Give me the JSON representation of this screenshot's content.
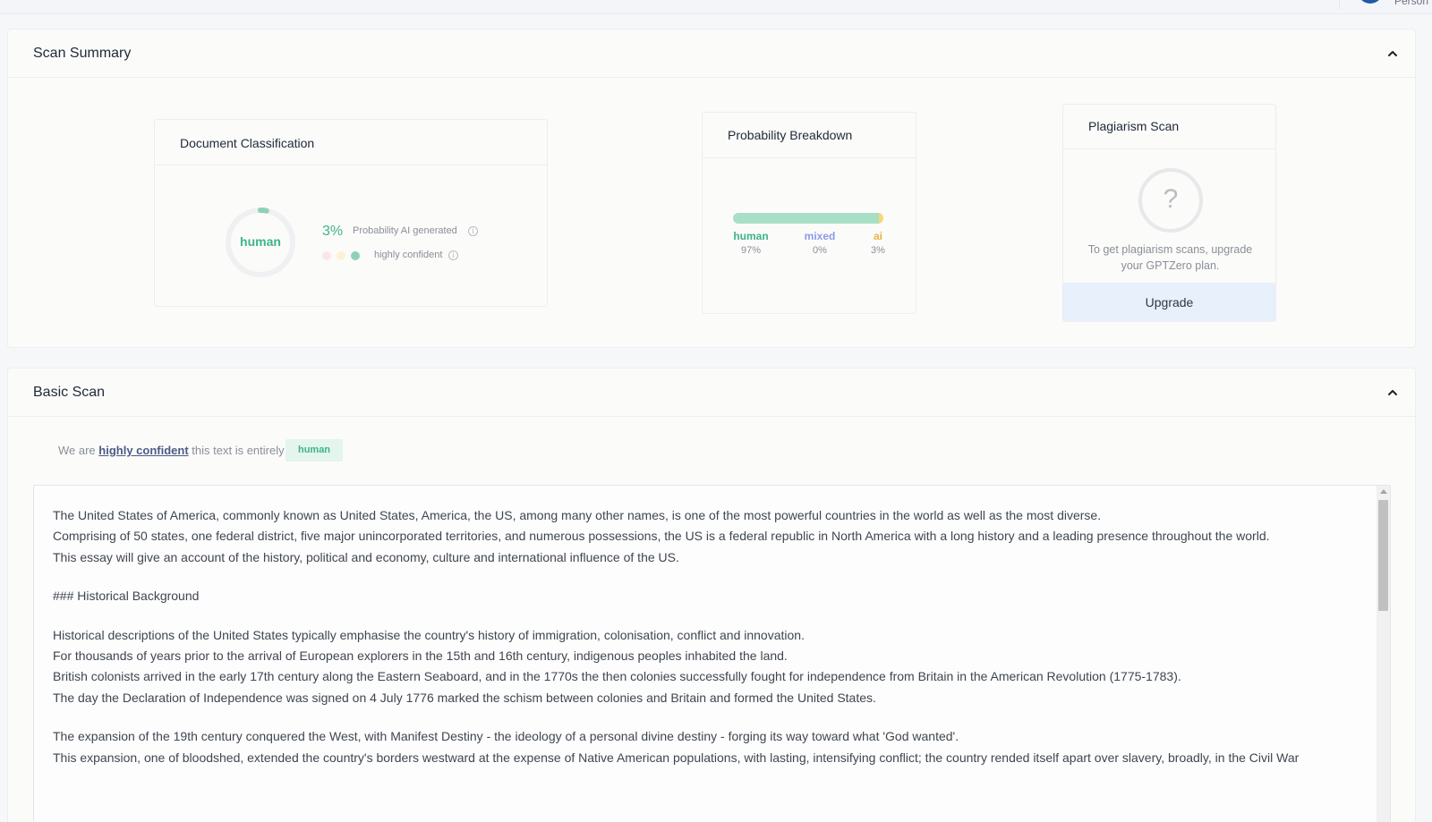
{
  "topbar": {
    "user_label": "Person"
  },
  "summary": {
    "title": "Scan Summary",
    "classification": {
      "title": "Document Classification",
      "donut_label": "human",
      "ai_percent": "3%",
      "ai_fraction": 0.03,
      "ai_caption": "Probability AI generated",
      "confidence_caption": "highly confident",
      "confidence_level": 3,
      "dot_colors": [
        "#fce5e5",
        "#fbf4d2",
        "#8fd2b3"
      ]
    },
    "breakdown": {
      "title": "Probability Breakdown",
      "segments": [
        {
          "name": "human",
          "value": "97%",
          "fraction": 0.97,
          "color": "#a8dfc6",
          "label_color": "#3fb38a"
        },
        {
          "name": "mixed",
          "value": "0%",
          "fraction": 0.0,
          "color": "#9aa6e8",
          "label_color": "#8b9be6"
        },
        {
          "name": "ai",
          "value": "3%",
          "fraction": 0.03,
          "color": "#f6d77a",
          "label_color": "#e5b43c"
        }
      ]
    },
    "plagiarism": {
      "title": "Plagiarism Scan",
      "question_mark": "?",
      "message": "To get plagiarism scans, upgrade your GPTZero plan.",
      "upgrade_label": "Upgrade"
    }
  },
  "basic": {
    "title": "Basic Scan",
    "verdict_prefix": "We are ",
    "verdict_link": "highly confident",
    "verdict_suffix": " this text is entirely",
    "badge": "human",
    "text_lines": [
      "The United States of America, commonly known as United States, America, the US, among many other names, is one of the most powerful countries in the world as well as the most diverse.",
      "Comprising of 50 states, one federal district, five major unincorporated territories, and numerous possessions, the US is a federal republic in North America with a long history and a leading presence throughout the world.",
      "This essay will give an account of the history, political and economy, culture and international influence of the US.",
      "",
      "### Historical Background",
      "",
      "Historical descriptions of the United States typically emphasise the country's history of immigration, colonisation, conflict and innovation.",
      "For thousands of years prior to the arrival of European explorers in the 15th and 16th century, indigenous peoples inhabited the land.",
      "British colonists arrived in the early 17th century along the Eastern Seaboard, and in the 1770s the then colonies successfully fought for independence from Britain in the American Revolution (1775-1783).",
      "The day the Declaration of Independence was signed on 4 July 1776 marked the schism between colonies and Britain and formed the United States.",
      "",
      "The expansion of the 19th century conquered the West, with Manifest Destiny - the ideology of a personal divine destiny - forging its way toward what 'God wanted'.",
      "This expansion, one of bloodshed, extended the country's borders westward at the expense of Native American populations, with lasting, intensifying conflict; the country rended itself apart over slavery, broadly, in the Civil War"
    ]
  }
}
